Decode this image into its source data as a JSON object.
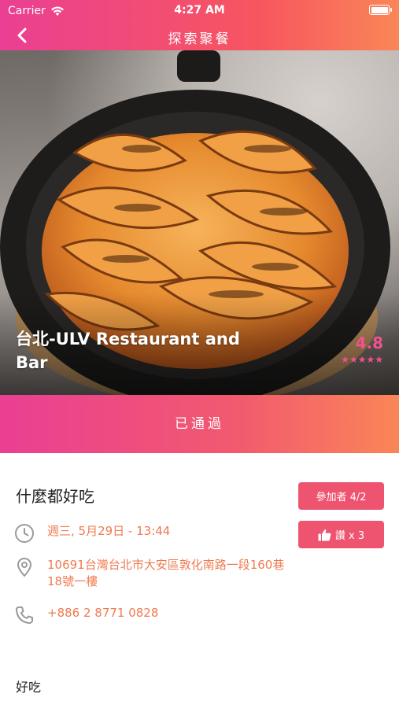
{
  "status_bar": {
    "carrier": "Carrier",
    "time": "4:27 AM"
  },
  "nav": {
    "title": "探索聚餐"
  },
  "restaurant": {
    "name": "台北-ULV Restaurant and Bar",
    "rating": "4.8",
    "stars": "★★★★★"
  },
  "banner": {
    "status": "已通過"
  },
  "event": {
    "title": "什麼都好吃",
    "participants_label": "參加者 4/2",
    "likes_label": "讚 x 3",
    "datetime": "週三, 5月29日 - 13:44",
    "address": "10691台灣台北市大安區敦化南路一段160巷18號一樓",
    "phone": "+886 2 8771 0828",
    "description": "好吃"
  },
  "colors": {
    "accent_pink": "#ea3f93",
    "accent_orange": "#fa8657",
    "button": "#ee5470",
    "info_text": "#f07a50"
  }
}
